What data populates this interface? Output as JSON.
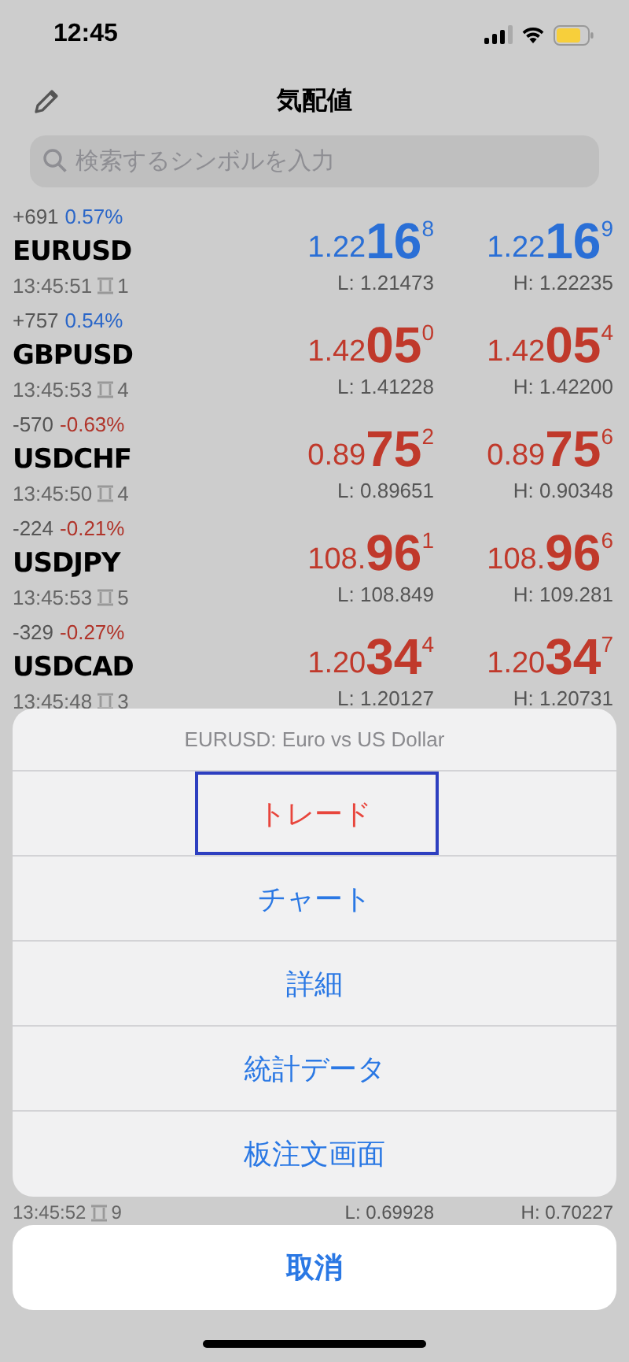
{
  "status_bar": {
    "time": "12:45"
  },
  "nav": {
    "title": "気配値"
  },
  "search": {
    "placeholder": "検索するシンボルを入力"
  },
  "quotes": [
    {
      "points": "+691",
      "percent": {
        "text": "0.57%",
        "color": "#2a66c8"
      },
      "symbol": "EURUSD",
      "time": "13:45:51",
      "spread": "1",
      "bid": {
        "prefix": "1.22",
        "big": "16",
        "sup": "8",
        "color": "#2a6fd6"
      },
      "ask": {
        "prefix": "1.22",
        "big": "16",
        "sup": "9",
        "color": "#2a6fd6"
      },
      "low": "L: 1.21473",
      "high": "H: 1.22235"
    },
    {
      "points": "+757",
      "percent": {
        "text": "0.54%",
        "color": "#2a66c8"
      },
      "symbol": "GBPUSD",
      "time": "13:45:53",
      "spread": "4",
      "bid": {
        "prefix": "1.42",
        "big": "05",
        "sup": "0",
        "color": "#c0392b"
      },
      "ask": {
        "prefix": "1.42",
        "big": "05",
        "sup": "4",
        "color": "#c0392b"
      },
      "low": "L: 1.41228",
      "high": "H: 1.42200"
    },
    {
      "points": "-570",
      "percent": {
        "text": "-0.63%",
        "color": "#b0342a"
      },
      "symbol": "USDCHF",
      "time": "13:45:50",
      "spread": "4",
      "bid": {
        "prefix": "0.89",
        "big": "75",
        "sup": "2",
        "color": "#c0392b"
      },
      "ask": {
        "prefix": "0.89",
        "big": "75",
        "sup": "6",
        "color": "#c0392b"
      },
      "low": "L: 0.89651",
      "high": "H: 0.90348"
    },
    {
      "points": "-224",
      "percent": {
        "text": "-0.21%",
        "color": "#b0342a"
      },
      "symbol": "USDJPY",
      "time": "13:45:53",
      "spread": "5",
      "bid": {
        "prefix": "108.",
        "big": "96",
        "sup": "1",
        "color": "#c0392b"
      },
      "ask": {
        "prefix": "108.",
        "big": "96",
        "sup": "6",
        "color": "#c0392b"
      },
      "low": "L: 108.849",
      "high": "H: 109.281"
    },
    {
      "points": "-329",
      "percent": {
        "text": "-0.27%",
        "color": "#b0342a"
      },
      "symbol": "USDCAD",
      "time": "13:45:48",
      "spread": "3",
      "bid": {
        "prefix": "1.20",
        "big": "34",
        "sup": "4",
        "color": "#c0392b"
      },
      "ask": {
        "prefix": "1.20",
        "big": "34",
        "sup": "7",
        "color": "#c0392b"
      },
      "low": "L: 1.20127",
      "high": "H: 1.20731"
    }
  ],
  "peek_row": {
    "time": "13:45:52",
    "spread": "9",
    "low": "L: 0.69928",
    "high": "H: 0.70227"
  },
  "action_sheet": {
    "title": "EURUSD: Euro vs US Dollar",
    "actions": [
      {
        "label": "トレード",
        "kind": "destructive",
        "selected": true
      },
      {
        "label": "チャート",
        "kind": "default",
        "selected": false
      },
      {
        "label": "詳細",
        "kind": "default",
        "selected": false
      },
      {
        "label": "統計データ",
        "kind": "default",
        "selected": false
      },
      {
        "label": "板注文画面",
        "kind": "default",
        "selected": false
      }
    ],
    "cancel": "取消"
  }
}
